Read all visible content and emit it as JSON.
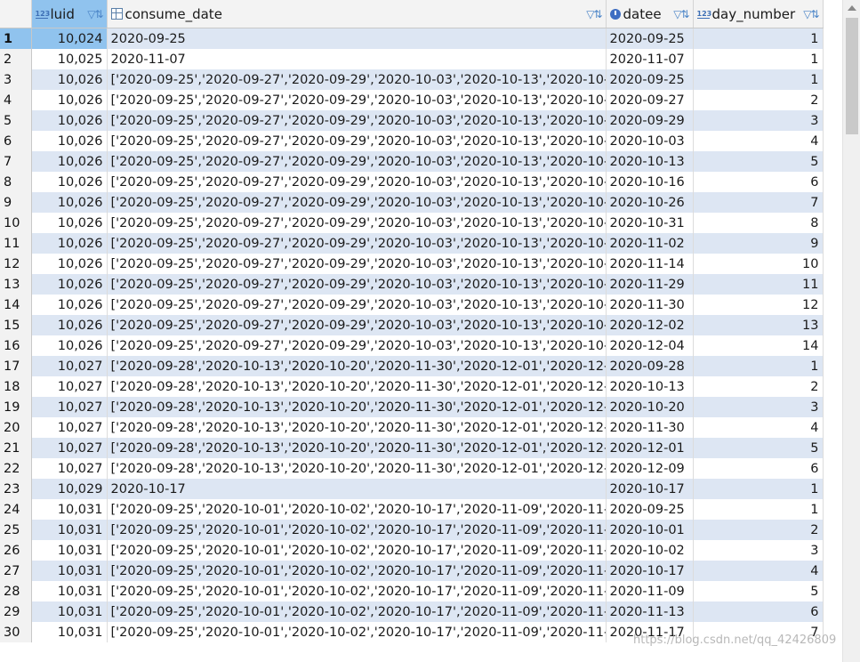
{
  "columns": [
    {
      "name": "luid",
      "type_icon": "123"
    },
    {
      "name": "consume_date",
      "type_icon": "grid"
    },
    {
      "name": "datee",
      "type_icon": "clock"
    },
    {
      "name": "day_number",
      "type_icon": "123"
    }
  ],
  "rows": [
    {
      "n": "1",
      "luid": "10,024",
      "consume_date": "2020-09-25",
      "datee": "2020-09-25",
      "day_number": "1"
    },
    {
      "n": "2",
      "luid": "10,025",
      "consume_date": "2020-11-07",
      "datee": "2020-11-07",
      "day_number": "1"
    },
    {
      "n": "3",
      "luid": "10,026",
      "consume_date": "['2020-09-25','2020-09-27','2020-09-29','2020-10-03','2020-10-13','2020-10-",
      "datee": "2020-09-25",
      "day_number": "1"
    },
    {
      "n": "4",
      "luid": "10,026",
      "consume_date": "['2020-09-25','2020-09-27','2020-09-29','2020-10-03','2020-10-13','2020-10-",
      "datee": "2020-09-27",
      "day_number": "2"
    },
    {
      "n": "5",
      "luid": "10,026",
      "consume_date": "['2020-09-25','2020-09-27','2020-09-29','2020-10-03','2020-10-13','2020-10-",
      "datee": "2020-09-29",
      "day_number": "3"
    },
    {
      "n": "6",
      "luid": "10,026",
      "consume_date": "['2020-09-25','2020-09-27','2020-09-29','2020-10-03','2020-10-13','2020-10-",
      "datee": "2020-10-03",
      "day_number": "4"
    },
    {
      "n": "7",
      "luid": "10,026",
      "consume_date": "['2020-09-25','2020-09-27','2020-09-29','2020-10-03','2020-10-13','2020-10-",
      "datee": "2020-10-13",
      "day_number": "5"
    },
    {
      "n": "8",
      "luid": "10,026",
      "consume_date": "['2020-09-25','2020-09-27','2020-09-29','2020-10-03','2020-10-13','2020-10-",
      "datee": "2020-10-16",
      "day_number": "6"
    },
    {
      "n": "9",
      "luid": "10,026",
      "consume_date": "['2020-09-25','2020-09-27','2020-09-29','2020-10-03','2020-10-13','2020-10-",
      "datee": "2020-10-26",
      "day_number": "7"
    },
    {
      "n": "10",
      "luid": "10,026",
      "consume_date": "['2020-09-25','2020-09-27','2020-09-29','2020-10-03','2020-10-13','2020-10-",
      "datee": "2020-10-31",
      "day_number": "8"
    },
    {
      "n": "11",
      "luid": "10,026",
      "consume_date": "['2020-09-25','2020-09-27','2020-09-29','2020-10-03','2020-10-13','2020-10-",
      "datee": "2020-11-02",
      "day_number": "9"
    },
    {
      "n": "12",
      "luid": "10,026",
      "consume_date": "['2020-09-25','2020-09-27','2020-09-29','2020-10-03','2020-10-13','2020-10-",
      "datee": "2020-11-14",
      "day_number": "10"
    },
    {
      "n": "13",
      "luid": "10,026",
      "consume_date": "['2020-09-25','2020-09-27','2020-09-29','2020-10-03','2020-10-13','2020-10-",
      "datee": "2020-11-29",
      "day_number": "11"
    },
    {
      "n": "14",
      "luid": "10,026",
      "consume_date": "['2020-09-25','2020-09-27','2020-09-29','2020-10-03','2020-10-13','2020-10-",
      "datee": "2020-11-30",
      "day_number": "12"
    },
    {
      "n": "15",
      "luid": "10,026",
      "consume_date": "['2020-09-25','2020-09-27','2020-09-29','2020-10-03','2020-10-13','2020-10-",
      "datee": "2020-12-02",
      "day_number": "13"
    },
    {
      "n": "16",
      "luid": "10,026",
      "consume_date": "['2020-09-25','2020-09-27','2020-09-29','2020-10-03','2020-10-13','2020-10-",
      "datee": "2020-12-04",
      "day_number": "14"
    },
    {
      "n": "17",
      "luid": "10,027",
      "consume_date": "['2020-09-28','2020-10-13','2020-10-20','2020-11-30','2020-12-01','2020-12-",
      "datee": "2020-09-28",
      "day_number": "1"
    },
    {
      "n": "18",
      "luid": "10,027",
      "consume_date": "['2020-09-28','2020-10-13','2020-10-20','2020-11-30','2020-12-01','2020-12-",
      "datee": "2020-10-13",
      "day_number": "2"
    },
    {
      "n": "19",
      "luid": "10,027",
      "consume_date": "['2020-09-28','2020-10-13','2020-10-20','2020-11-30','2020-12-01','2020-12-",
      "datee": "2020-10-20",
      "day_number": "3"
    },
    {
      "n": "20",
      "luid": "10,027",
      "consume_date": "['2020-09-28','2020-10-13','2020-10-20','2020-11-30','2020-12-01','2020-12-",
      "datee": "2020-11-30",
      "day_number": "4"
    },
    {
      "n": "21",
      "luid": "10,027",
      "consume_date": "['2020-09-28','2020-10-13','2020-10-20','2020-11-30','2020-12-01','2020-12-",
      "datee": "2020-12-01",
      "day_number": "5"
    },
    {
      "n": "22",
      "luid": "10,027",
      "consume_date": "['2020-09-28','2020-10-13','2020-10-20','2020-11-30','2020-12-01','2020-12-",
      "datee": "2020-12-09",
      "day_number": "6"
    },
    {
      "n": "23",
      "luid": "10,029",
      "consume_date": "2020-10-17",
      "datee": "2020-10-17",
      "day_number": "1"
    },
    {
      "n": "24",
      "luid": "10,031",
      "consume_date": "['2020-09-25','2020-10-01','2020-10-02','2020-10-17','2020-11-09','2020-11-",
      "datee": "2020-09-25",
      "day_number": "1"
    },
    {
      "n": "25",
      "luid": "10,031",
      "consume_date": "['2020-09-25','2020-10-01','2020-10-02','2020-10-17','2020-11-09','2020-11-",
      "datee": "2020-10-01",
      "day_number": "2"
    },
    {
      "n": "26",
      "luid": "10,031",
      "consume_date": "['2020-09-25','2020-10-01','2020-10-02','2020-10-17','2020-11-09','2020-11-",
      "datee": "2020-10-02",
      "day_number": "3"
    },
    {
      "n": "27",
      "luid": "10,031",
      "consume_date": "['2020-09-25','2020-10-01','2020-10-02','2020-10-17','2020-11-09','2020-11-",
      "datee": "2020-10-17",
      "day_number": "4"
    },
    {
      "n": "28",
      "luid": "10,031",
      "consume_date": "['2020-09-25','2020-10-01','2020-10-02','2020-10-17','2020-11-09','2020-11-",
      "datee": "2020-11-09",
      "day_number": "5"
    },
    {
      "n": "29",
      "luid": "10,031",
      "consume_date": "['2020-09-25','2020-10-01','2020-10-02','2020-10-17','2020-11-09','2020-11-",
      "datee": "2020-11-13",
      "day_number": "6"
    },
    {
      "n": "30",
      "luid": "10,031",
      "consume_date": "['2020-09-25','2020-10-01','2020-10-02','2020-10-17','2020-11-09','2020-11-",
      "datee": "2020-11-17",
      "day_number": "7"
    }
  ],
  "watermark": "https://blog.csdn.net/qq_42426809",
  "colors": {
    "row_alt": "#dde6f3",
    "selection": "#90c3ee",
    "header_bg": "#f3f3f3"
  }
}
